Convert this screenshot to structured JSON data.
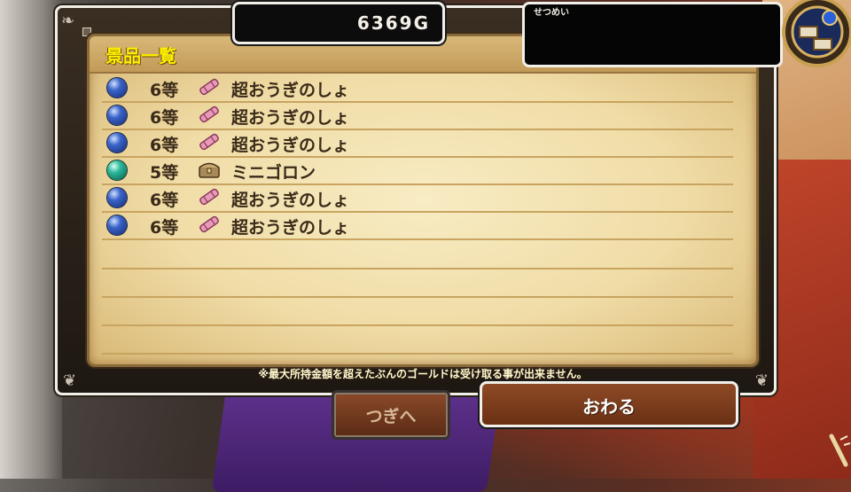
{
  "gold": {
    "value": "6369G"
  },
  "description": {
    "label": "せつめい"
  },
  "panel": {
    "title": "景品一覧",
    "items": [
      {
        "rank": "6等",
        "name": "超おうぎのしょ",
        "orb": "blue",
        "icon": "scroll-icon"
      },
      {
        "rank": "6等",
        "name": "超おうぎのしょ",
        "orb": "blue",
        "icon": "scroll-icon"
      },
      {
        "rank": "6等",
        "name": "超おうぎのしょ",
        "orb": "blue",
        "icon": "scroll-icon"
      },
      {
        "rank": "5等",
        "name": "ミニゴロン",
        "orb": "teal",
        "icon": "treasure-chest-icon"
      },
      {
        "rank": "6等",
        "name": "超おうぎのしょ",
        "orb": "blue",
        "icon": "scroll-icon"
      },
      {
        "rank": "6等",
        "name": "超おうぎのしょ",
        "orb": "blue",
        "icon": "scroll-icon"
      }
    ],
    "notice": "※最大所持金額を超えたぶんのゴールドは受け取る事が出来ません。"
  },
  "buttons": {
    "next_label": "つぎへ",
    "end_label": "おわる"
  },
  "colors": {
    "title": "#fff200",
    "parchment": "#f0dca6",
    "button": "#8e4a26"
  }
}
